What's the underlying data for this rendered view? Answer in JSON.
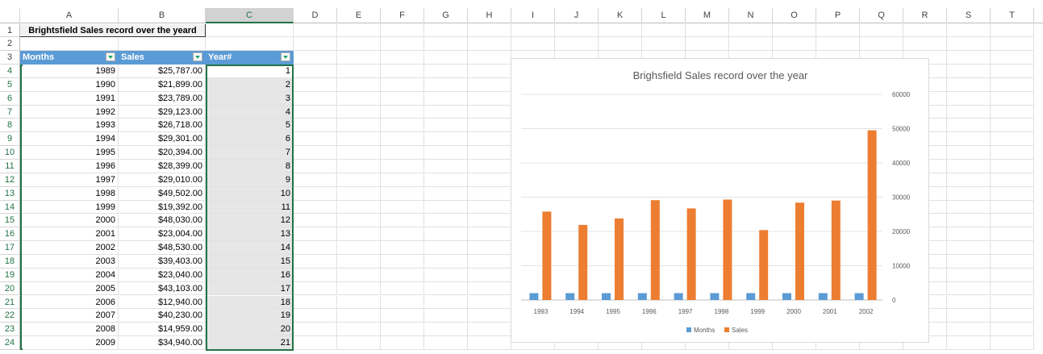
{
  "columns": [
    "A",
    "B",
    "C",
    "D",
    "E",
    "F",
    "G",
    "H",
    "I",
    "J",
    "K",
    "L",
    "M",
    "N",
    "O",
    "P",
    "Q",
    "R",
    "S",
    "T"
  ],
  "sheet": {
    "title": "Brightsfield Sales record over the yeard",
    "headers": [
      "Months",
      "Sales",
      "Year#"
    ],
    "rows": [
      [
        "1989",
        "$25,787.00",
        "1"
      ],
      [
        "1990",
        "$21,899.00",
        "2"
      ],
      [
        "1991",
        "$23,789.00",
        "3"
      ],
      [
        "1992",
        "$29,123.00",
        "4"
      ],
      [
        "1993",
        "$26,718.00",
        "5"
      ],
      [
        "1994",
        "$29,301.00",
        "6"
      ],
      [
        "1995",
        "$20,394.00",
        "7"
      ],
      [
        "1996",
        "$28,399.00",
        "8"
      ],
      [
        "1997",
        "$29,010.00",
        "9"
      ],
      [
        "1998",
        "$49,502.00",
        "10"
      ],
      [
        "1999",
        "$19,392.00",
        "11"
      ],
      [
        "2000",
        "$48,030.00",
        "12"
      ],
      [
        "2001",
        "$23,004.00",
        "13"
      ],
      [
        "2002",
        "$48,530.00",
        "14"
      ],
      [
        "2003",
        "$39,403.00",
        "15"
      ],
      [
        "2004",
        "$23,040.00",
        "16"
      ],
      [
        "2005",
        "$43,103.00",
        "17"
      ],
      [
        "2006",
        "$12,940.00",
        "18"
      ],
      [
        "2007",
        "$40,230.00",
        "19"
      ],
      [
        "2008",
        "$14,959.00",
        "20"
      ],
      [
        "2009",
        "$34,940.00",
        "21"
      ]
    ]
  },
  "chart_data": {
    "type": "bar",
    "title": "Brighsfield Sales record over the year",
    "categories": [
      "1993",
      "1994",
      "1995",
      "1996",
      "1997",
      "1998",
      "1999",
      "2000",
      "2001",
      "2002"
    ],
    "series": [
      {
        "name": "Months",
        "color": "#5b9bd5",
        "values": [
          1989,
          1990,
          1991,
          1992,
          1993,
          1994,
          1995,
          1996,
          1997,
          1998
        ]
      },
      {
        "name": "Sales",
        "color": "#ed7d31",
        "values": [
          25787,
          21899,
          23789,
          29123,
          26718,
          29301,
          20394,
          28399,
          29010,
          49502
        ]
      }
    ],
    "yticks": [
      "0",
      "10000",
      "20000",
      "30000",
      "40000",
      "50000",
      "60000"
    ],
    "ylim": [
      0,
      60000
    ],
    "legend": "bottom",
    "grid": true
  }
}
